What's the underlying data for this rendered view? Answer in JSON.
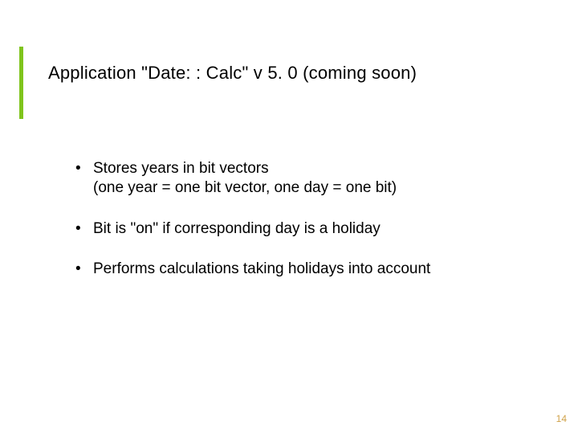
{
  "title": "Application \"Date: : Calc\" v 5. 0 (coming soon)",
  "bullets": [
    {
      "line1": "Stores years in bit vectors",
      "line2": "(one year = one bit vector, one day = one bit)"
    },
    {
      "line1": "Bit is \"on\" if corresponding day is a holiday",
      "line2": ""
    },
    {
      "line1": "Performs calculations taking holidays into account",
      "line2": ""
    }
  ],
  "page_number": "14"
}
